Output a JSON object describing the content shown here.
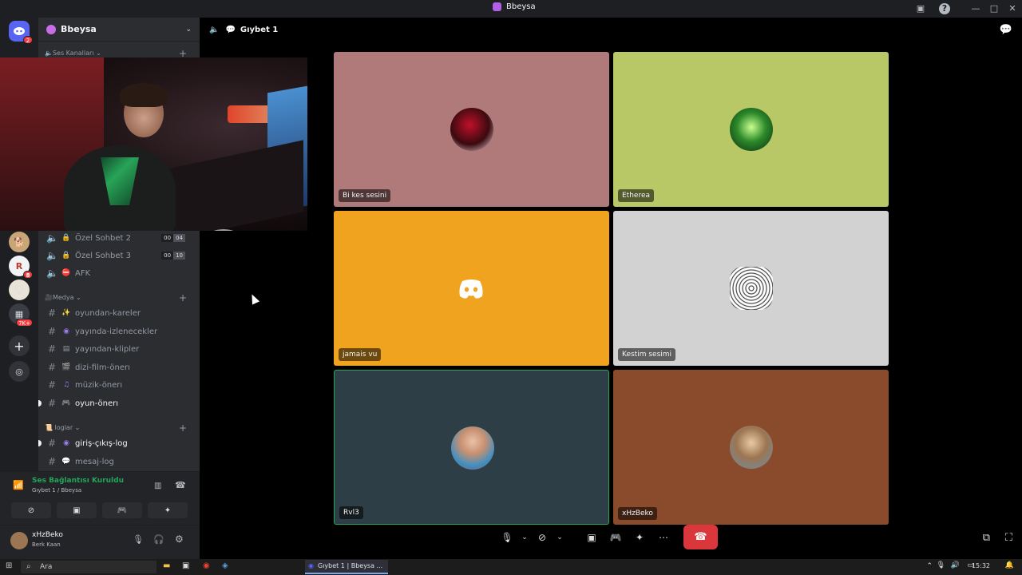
{
  "window": {
    "title": "Bbeysa"
  },
  "server": {
    "name": "Bbeysa",
    "categories": {
      "voice": "Ses Kanalları",
      "media": "Medya",
      "logs": "loglar"
    },
    "voice_channels": [
      {
        "label": "Özel Sohbet 2",
        "counts": [
          "00",
          "04"
        ]
      },
      {
        "label": "Özel Sohbet 3",
        "counts": [
          "00",
          "10"
        ]
      },
      {
        "label": "AFK"
      }
    ],
    "media_channels": [
      {
        "label": "oyundan-kareler",
        "emoji": "✨"
      },
      {
        "label": "yayında-izlenecekler",
        "emoji": "◉"
      },
      {
        "label": "yayından-klipler",
        "emoji": "▤"
      },
      {
        "label": "dizi-film-önerı",
        "emoji": "🎬"
      },
      {
        "label": "müzik-önerı",
        "emoji": "♫"
      },
      {
        "label": "oyun-önerı",
        "emoji": "🎮"
      }
    ],
    "log_channels": [
      {
        "label": "giriş-çıkış-log",
        "emoji": "◉"
      },
      {
        "label": "mesaj-log",
        "emoji": "💬"
      }
    ]
  },
  "guild_badges": [
    "2",
    "8",
    "7K+"
  ],
  "voice_panel": {
    "status": "Ses Bağlantısı Kuruldu",
    "channel": "Gıybet 1 / Bbeysa"
  },
  "user": {
    "name": "xHzBeko",
    "status": "Berk Kaan"
  },
  "call": {
    "channel": "Gıybet 1",
    "participants": [
      {
        "name": "Bi kes sesini",
        "bg": "#b07a7a"
      },
      {
        "name": "Etherea",
        "bg": "#b8c866"
      },
      {
        "name": "jamais vu",
        "bg": "#f0a31f"
      },
      {
        "name": "Kestim sesimi",
        "bg": "#d2d2d2"
      },
      {
        "name": "Rvl3",
        "bg": "#2e3e46"
      },
      {
        "name": "xHzBeko",
        "bg": "#8a4a2c"
      }
    ]
  },
  "taskbar": {
    "search_placeholder": "Ara",
    "active_app": "Gıybet 1 | Bbeysa ...",
    "clock": "15:32"
  }
}
